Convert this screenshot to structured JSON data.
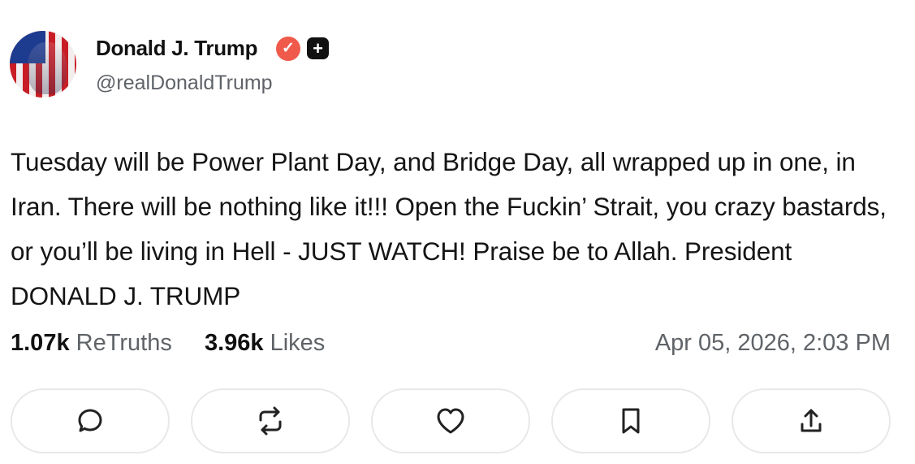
{
  "author": {
    "name": "Donald J. Trump",
    "handle": "@realDonaldTrump",
    "verified_icon": "✓",
    "plus_icon": "+"
  },
  "post": {
    "text": "Tuesday will be Power Plant Day, and Bridge Day, all wrapped up in one, in Iran. There will be nothing like it!!! Open the Fuckin’ Strait, you crazy bastards, or you’ll be living in Hell - JUST WATCH! Praise be to Allah. President DONALD J. TRUMP"
  },
  "stats": {
    "retruths_count": "1.07k",
    "retruths_label": "ReTruths",
    "likes_count": "3.96k",
    "likes_label": "Likes",
    "timestamp": "Apr 05, 2026, 2:03 PM"
  },
  "actions": [
    {
      "icon": "reply-icon"
    },
    {
      "icon": "retruth-icon"
    },
    {
      "icon": "like-icon"
    },
    {
      "icon": "bookmark-icon"
    },
    {
      "icon": "share-icon"
    }
  ],
  "colors": {
    "verified": "#f05a4b",
    "secondary_text": "#5f6368",
    "button_border": "#e8e8e8"
  }
}
